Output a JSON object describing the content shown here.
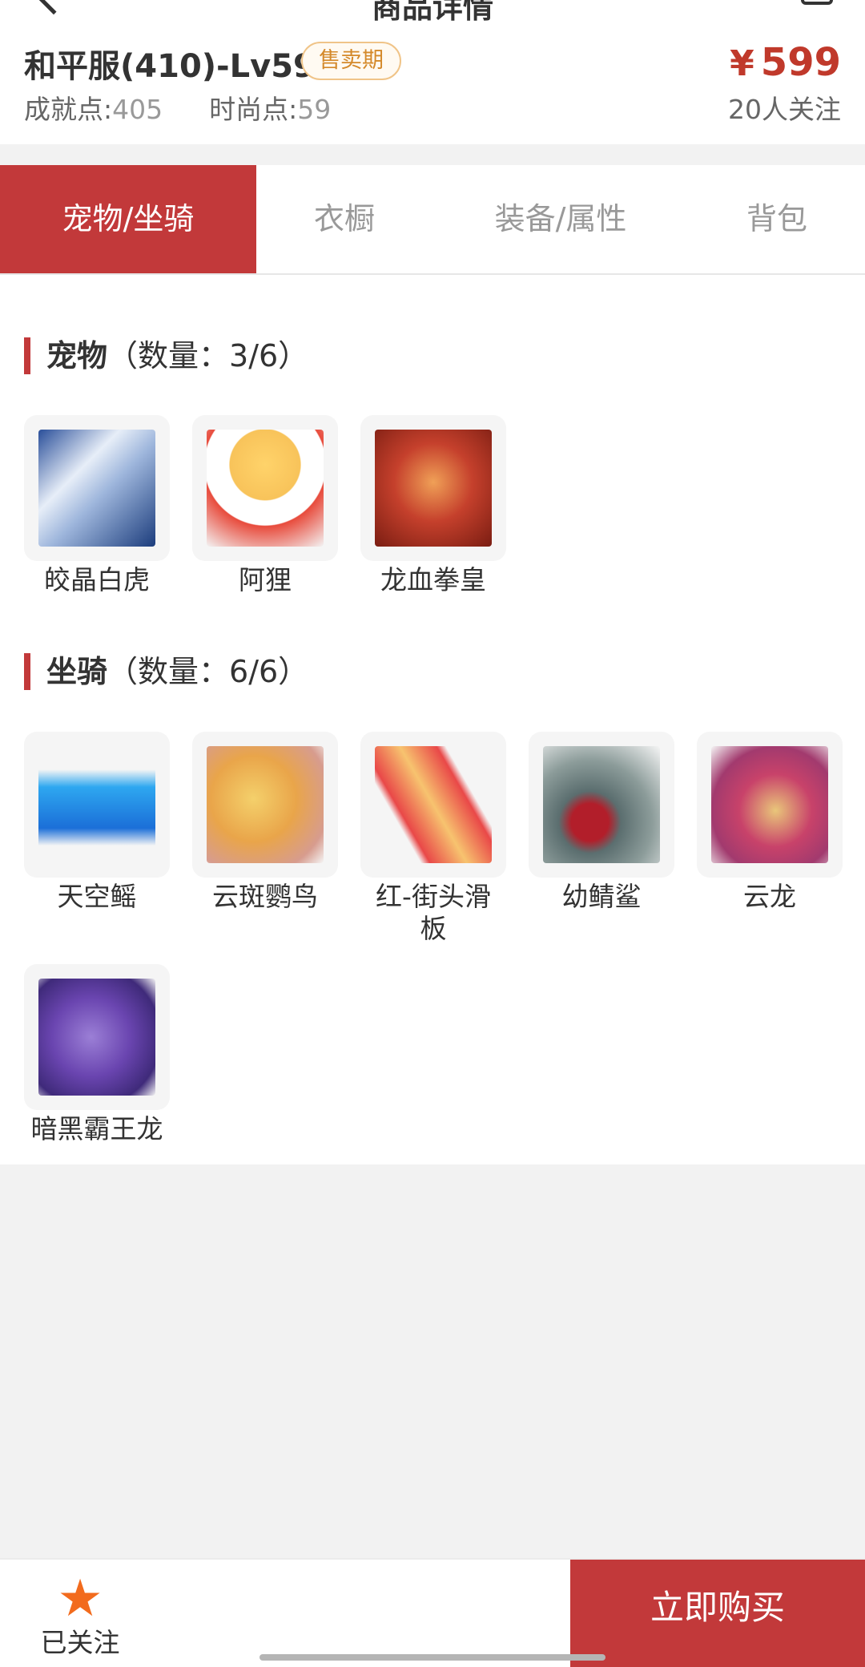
{
  "nav": {
    "title": "商品详情"
  },
  "header": {
    "title": "和平服(410)-Lv59",
    "badge": "售卖期",
    "achievement_label": "成就点:",
    "achievement_value": "405",
    "fashion_label": "时尚点:",
    "fashion_value": "59",
    "price_symbol": "¥",
    "price": "599",
    "followers": "20人关注"
  },
  "tabs": [
    {
      "label": "宠物/坐骑",
      "active": true
    },
    {
      "label": "衣橱",
      "active": false
    },
    {
      "label": "装备/属性",
      "active": false
    },
    {
      "label": "背包",
      "active": false
    }
  ],
  "pets": {
    "heading": "宠物",
    "count": "（数量：3/6）",
    "items": [
      {
        "name": "皎晶白虎",
        "icon": "tiger"
      },
      {
        "name": "阿狸",
        "icon": "ali"
      },
      {
        "name": "龙血拳皇",
        "icon": "dragon-king"
      }
    ]
  },
  "mounts": {
    "heading": "坐骑",
    "count": "（数量：6/6）",
    "items": [
      {
        "name": "天空鳐",
        "icon": "sky-ray"
      },
      {
        "name": "云斑鹦鸟",
        "icon": "parrot"
      },
      {
        "name": "红-街头滑板",
        "icon": "skateboard"
      },
      {
        "name": "幼鲭鲨",
        "icon": "shark"
      },
      {
        "name": "云龙",
        "icon": "cloud-dragon"
      },
      {
        "name": "暗黑霸王龙",
        "icon": "t-rex"
      }
    ]
  },
  "bottom": {
    "follow_label": "已关注",
    "buy_label": "立即购买",
    "accent_color": "#c2393a"
  }
}
